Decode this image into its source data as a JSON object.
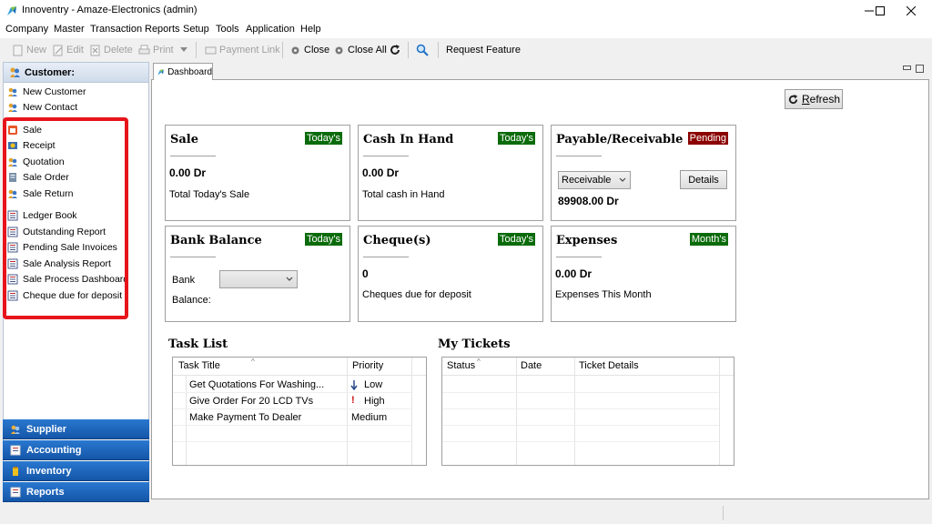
{
  "window": {
    "title": "Innoventry - Amaze-Electronics (admin)",
    "minimize": "—",
    "maximize": "☐",
    "close": "✕"
  },
  "menu": [
    "Company",
    "Master",
    "Transaction",
    "Reports",
    "Setup",
    "Tools",
    "Application",
    "Help"
  ],
  "toolbar": {
    "new": "New",
    "edit": "Edit",
    "delete": "Delete",
    "print": "Print",
    "payment_link": "Payment Link",
    "close": "Close",
    "close_all": "Close All",
    "request_feature": "Request Feature"
  },
  "sidebar": {
    "header": "Customer:",
    "top_items": [
      "New Customer",
      "New Contact"
    ],
    "transaction_items": [
      "Sale",
      "Receipt",
      "Quotation",
      "Sale Order",
      "Sale Return"
    ],
    "report_items": [
      "Ledger Book",
      "Outstanding Report",
      "Pending Sale Invoices",
      "Sale Analysis Report",
      "Sale Process Dashboard",
      "Cheque due for deposit"
    ],
    "sections": [
      "Supplier",
      "Accounting",
      "Inventory",
      "Reports"
    ]
  },
  "tab": {
    "label": "Dashboard"
  },
  "refresh": {
    "label_first": "R",
    "label_rest": "efresh"
  },
  "cards": {
    "sale": {
      "title": "Sale",
      "badge": "Today's",
      "value": "0.00 Dr",
      "sub": "Total Today's Sale"
    },
    "cash": {
      "title": "Cash In Hand",
      "badge": "Today's",
      "value": "0.00 Dr",
      "sub": "Total cash in Hand"
    },
    "payable": {
      "title": "Payable/Receivable",
      "badge": "Pending",
      "select": "Receivable",
      "details": "Details",
      "value": "89908.00 Dr"
    },
    "bank": {
      "title": "Bank Balance",
      "badge": "Today's",
      "bank_label": "Bank",
      "balance_label": "Balance:"
    },
    "cheque": {
      "title": "Cheque(s)",
      "badge": "Today's",
      "value": "0",
      "sub": "Cheques due for deposit"
    },
    "expenses": {
      "title": "Expenses",
      "badge": "Month's",
      "value": "0.00 Dr",
      "sub": "Expenses This Month"
    }
  },
  "task_list": {
    "title": "Task List",
    "columns": [
      "Task Title",
      "Priority"
    ],
    "rows": [
      {
        "title": "Get Quotations For Washing...",
        "priority": "Low",
        "priority_icon": "down-arrow-icon"
      },
      {
        "title": "Give Order For 20 LCD TVs",
        "priority": "High",
        "priority_icon": "exclamation-icon"
      },
      {
        "title": "Make Payment To Dealer",
        "priority": "Medium",
        "priority_icon": ""
      }
    ]
  },
  "tickets": {
    "title": "My Tickets",
    "columns": [
      "Status",
      "Date",
      "Ticket Details"
    ]
  },
  "colors": {
    "badge_green": "#0b6b0b",
    "badge_red": "#8b0000",
    "highlight": "#e8141b",
    "section_blue": "#1a62bd"
  }
}
